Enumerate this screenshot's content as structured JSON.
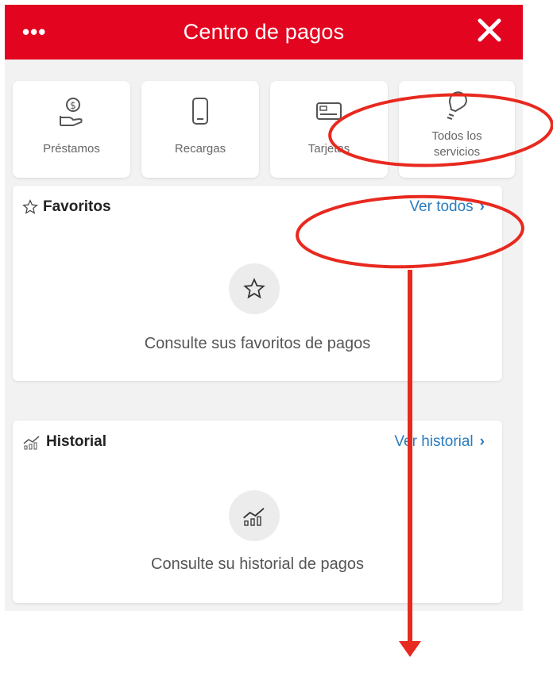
{
  "colors": {
    "brand": "#e3041f",
    "link": "#2a7bbf",
    "annotation": "#e8291f"
  },
  "header": {
    "title": "Centro de pagos",
    "menu_icon": "more-dots-icon",
    "close_icon": "close-icon"
  },
  "tiles": [
    {
      "icon": "loan-hand-coin-icon",
      "label": "Préstamos"
    },
    {
      "icon": "phone-icon",
      "label": "Recargas"
    },
    {
      "icon": "card-icon",
      "label": "Tarjetas"
    },
    {
      "icon": "lightbulb-icon",
      "label_line1": "Todos los",
      "label_line2": "servicios"
    }
  ],
  "favorites": {
    "title": "Favoritos",
    "link": "Ver todos",
    "message": "Consulte sus favoritos de pagos"
  },
  "history": {
    "title": "Historial",
    "link": "Ver historial",
    "message": "Consulte su historial de pagos"
  }
}
